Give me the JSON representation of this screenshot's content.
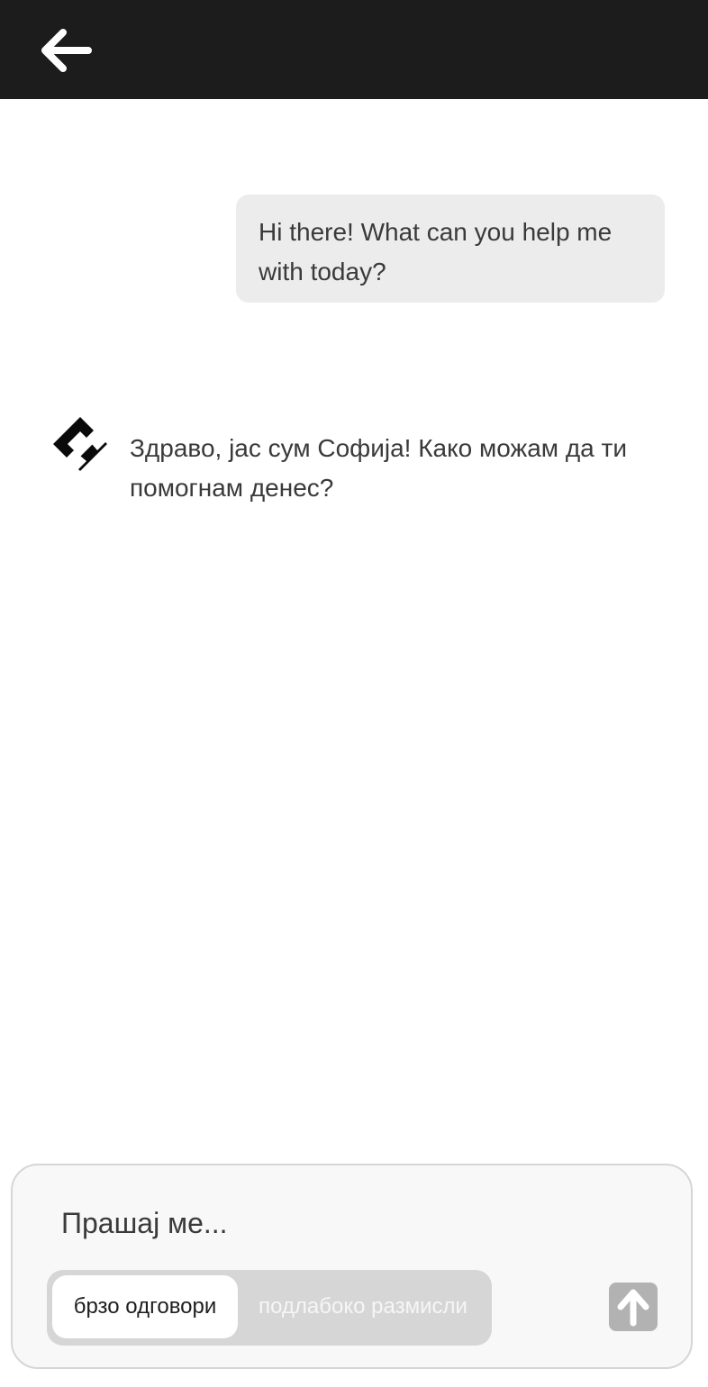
{
  "header": {
    "back_icon": "arrow-left-icon"
  },
  "conversation": {
    "user_message": "Hi there! What can you help me with today?",
    "bot_avatar_icon": "diamond-logo-icon",
    "bot_message": "Здраво, јас сум Софија! Како можам да ти помогнам денес?"
  },
  "composer": {
    "placeholder": "Прашај ме...",
    "modes": [
      {
        "label": "брзо одговори",
        "active": true
      },
      {
        "label": "подлабоко размисли",
        "active": false
      }
    ],
    "send_icon": "arrow-up-icon"
  },
  "colors": {
    "header_bg": "#1c1c1c",
    "user_bubble_bg": "#ececec",
    "send_button_bg": "#b2b2b2",
    "toggle_bg": "#d6d6d6"
  }
}
